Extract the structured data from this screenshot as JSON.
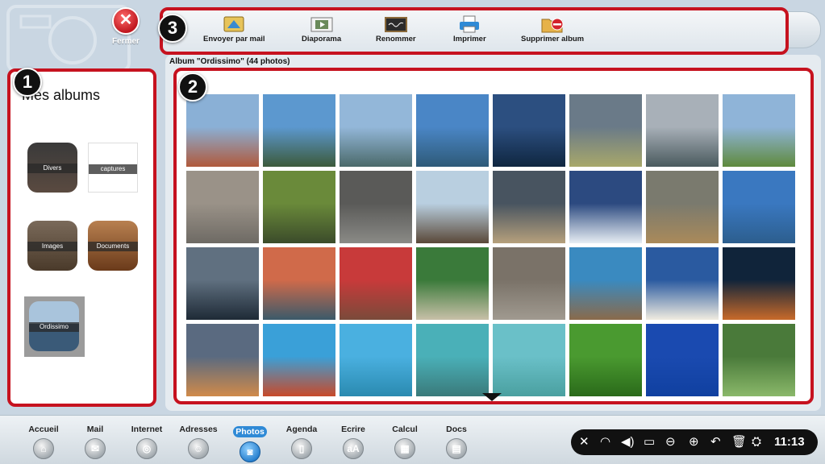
{
  "close": {
    "label": "Fermer",
    "icon": "close-icon"
  },
  "toolbar": {
    "items": [
      {
        "label": "Envoyer par mail",
        "icon": "send-mail-icon"
      },
      {
        "label": "Diaporama",
        "icon": "slideshow-icon"
      },
      {
        "label": "Renommer",
        "icon": "rename-icon"
      },
      {
        "label": "Imprimer",
        "icon": "printer-icon"
      },
      {
        "label": "Supprimer album",
        "icon": "delete-album-icon"
      }
    ]
  },
  "badges": [
    "1",
    "2",
    "3"
  ],
  "albums": {
    "title": "Mes albums",
    "items": [
      {
        "label": "Divers"
      },
      {
        "label": "captures"
      },
      {
        "label": "Images"
      },
      {
        "label": "Documents"
      },
      {
        "label": "Ordissimo",
        "selected": true
      }
    ]
  },
  "photos": {
    "header": "Album \"Ordissimo\" (44 photos)",
    "thumbnails": [
      {
        "colors": [
          "#8ab0d6",
          "#b0593b"
        ]
      },
      {
        "colors": [
          "#5c98cf",
          "#3c5a3a"
        ]
      },
      {
        "colors": [
          "#93b7d9",
          "#4b6a6a"
        ]
      },
      {
        "colors": [
          "#4a86c6",
          "#2e5a78"
        ]
      },
      {
        "colors": [
          "#2c4f80",
          "#0f2640"
        ]
      },
      {
        "colors": [
          "#6a7a88",
          "#a8a86a"
        ]
      },
      {
        "colors": [
          "#a8b0b8",
          "#4a5a5e"
        ]
      },
      {
        "colors": [
          "#8fb4d8",
          "#5f8a3c"
        ]
      },
      {
        "colors": [
          "#9a9288",
          "#6e6a64"
        ]
      },
      {
        "colors": [
          "#6a8a3a",
          "#3b4b2a"
        ]
      },
      {
        "colors": [
          "#5a5a58",
          "#8a8a86"
        ]
      },
      {
        "colors": [
          "#b9cfe0",
          "#5a4838"
        ]
      },
      {
        "colors": [
          "#485460",
          "#b6a07c"
        ]
      },
      {
        "colors": [
          "#2c4a80",
          "#e8eef4"
        ]
      },
      {
        "colors": [
          "#7a7a6e",
          "#aa8a5a"
        ]
      },
      {
        "colors": [
          "#3a78c0",
          "#2c5e8e"
        ]
      },
      {
        "colors": [
          "#607080",
          "#1e2a36"
        ]
      },
      {
        "colors": [
          "#d06a4a",
          "#3a5a6a"
        ]
      },
      {
        "colors": [
          "#c83a3a",
          "#7a4a3a"
        ]
      },
      {
        "colors": [
          "#3a7a3a",
          "#c8c0a8"
        ]
      },
      {
        "colors": [
          "#7a7268",
          "#a09a90"
        ]
      },
      {
        "colors": [
          "#3a8ac0",
          "#8a6a4a"
        ]
      },
      {
        "colors": [
          "#2a5aa0",
          "#f0ece0"
        ]
      },
      {
        "colors": [
          "#10243a",
          "#c86a2a"
        ]
      },
      {
        "colors": [
          "#5a6a80",
          "#d08a4a"
        ]
      },
      {
        "colors": [
          "#3aa0d8",
          "#c84a2a"
        ]
      },
      {
        "colors": [
          "#4ab0e0",
          "#2a8ab0"
        ]
      },
      {
        "colors": [
          "#4ab0b8",
          "#3a7a7a"
        ]
      },
      {
        "colors": [
          "#6ac0c8",
          "#4aa0a0"
        ]
      },
      {
        "colors": [
          "#4a9a30",
          "#2a6a1a"
        ]
      },
      {
        "colors": [
          "#1a4ab0",
          "#1040a0"
        ]
      },
      {
        "colors": [
          "#4a7a3a",
          "#8ab86a"
        ]
      }
    ]
  },
  "dock": {
    "items": [
      {
        "label": "Accueil",
        "icon": "home-icon",
        "glyph": "⌂"
      },
      {
        "label": "Mail",
        "icon": "mail-icon",
        "glyph": "✉"
      },
      {
        "label": "Internet",
        "icon": "globe-icon",
        "glyph": "◎"
      },
      {
        "label": "Adresses",
        "icon": "contacts-icon",
        "glyph": "☺"
      },
      {
        "label": "Photos",
        "icon": "camera-icon",
        "glyph": "◙",
        "active": true
      },
      {
        "label": "Agenda",
        "icon": "agenda-icon",
        "glyph": "▯"
      },
      {
        "label": "Ecrire",
        "icon": "write-icon",
        "glyph": "aA"
      },
      {
        "label": "Calcul",
        "icon": "calculator-icon",
        "glyph": "▦"
      },
      {
        "label": "Docs",
        "icon": "docs-icon",
        "glyph": "▤"
      }
    ]
  },
  "status": {
    "icons": [
      {
        "name": "tools-icon",
        "glyph": "✕"
      },
      {
        "name": "wifi-icon",
        "glyph": "◠"
      },
      {
        "name": "volume-icon",
        "glyph": "◀)"
      },
      {
        "name": "battery-icon",
        "glyph": "▭"
      },
      {
        "name": "zoom-out-icon",
        "glyph": "⊖"
      },
      {
        "name": "zoom-in-icon",
        "glyph": "⊕"
      },
      {
        "name": "undo-icon",
        "glyph": "↶"
      },
      {
        "name": "trash-icon",
        "glyph": "🗑"
      },
      {
        "name": "help-icon",
        "glyph": "⛭"
      }
    ],
    "time": "11:13"
  }
}
